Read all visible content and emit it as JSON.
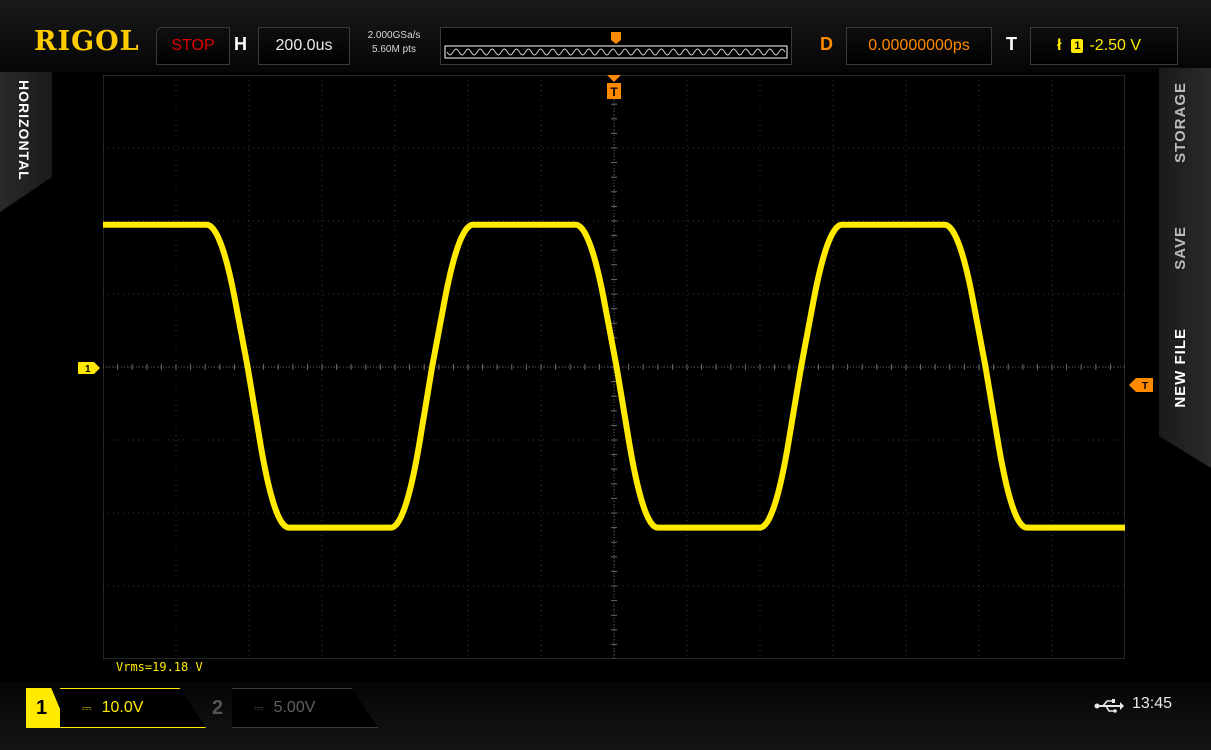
{
  "brand": "RIGOL",
  "status": "STOP",
  "horizontal": {
    "label": "H",
    "timebase": "200.0us",
    "sample_rate": "2.000GSa/s",
    "memory_depth": "5.60M pts"
  },
  "delay": {
    "label": "D",
    "value": "0.00000000ps"
  },
  "trigger": {
    "label": "T",
    "edge_icon": "falling-edge-icon",
    "edge_glyph": "ł",
    "source": "1",
    "level": "-2.50 V",
    "marker": "T"
  },
  "side_menu": {
    "left_tab": "HORIZONTAL",
    "right_tabs": [
      "STORAGE",
      "SAVE",
      "NEW FILE"
    ]
  },
  "measurement": "Vrms=19.18 V",
  "channels": [
    {
      "number": "1",
      "coupling_glyph": "⎓",
      "scale": "10.0V",
      "active": true,
      "color": "#ffea00"
    },
    {
      "number": "2",
      "coupling_glyph": "⎓",
      "scale": "5.00V",
      "active": false,
      "color": "#606060"
    }
  ],
  "clock": "13:45",
  "colors": {
    "ch1": "#ffea00",
    "trigger": "#ff8a00",
    "stop": "#e00000",
    "grid": "#3a3a3a"
  },
  "waveform": {
    "type": "trapezoid",
    "high_div": 1.95,
    "low_div": -2.2,
    "periods_on_screen": 2.77,
    "phase_start_div": 0.0
  }
}
